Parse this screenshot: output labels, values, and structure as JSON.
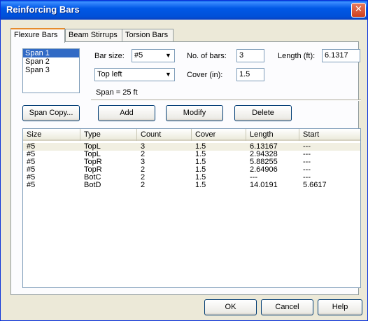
{
  "window": {
    "title": "Reinforcing Bars",
    "close_glyph": "✕"
  },
  "tabs": [
    {
      "label": "Flexure Bars",
      "active": true
    },
    {
      "label": "Beam Stirrups",
      "active": false
    },
    {
      "label": "Torsion Bars",
      "active": false
    }
  ],
  "spans": {
    "items": [
      "Span 1",
      "Span 2",
      "Span 3"
    ],
    "selected": "Span 1"
  },
  "form": {
    "bar_size_label": "Bar size:",
    "bar_size_value": "#5",
    "no_of_bars_label": "No. of bars:",
    "no_of_bars_value": "3",
    "length_label": "Length (ft):",
    "length_value": "6.1317",
    "position_value": "Top left",
    "cover_label": "Cover (in):",
    "cover_value": "1.5",
    "span_info": "Span = 25 ft"
  },
  "buttons": {
    "span_copy": "Span Copy...",
    "add": "Add",
    "modify": "Modify",
    "delete": "Delete",
    "ok": "OK",
    "cancel": "Cancel",
    "help": "Help"
  },
  "table": {
    "columns": [
      "Size",
      "Type",
      "Count",
      "Cover",
      "Length",
      "Start"
    ],
    "rows": [
      [
        "#5",
        "TopL",
        "3",
        "1.5",
        "6.13167",
        "---"
      ],
      [
        "#5",
        "TopL",
        "2",
        "1.5",
        "2.94328",
        "---"
      ],
      [
        "#5",
        "TopR",
        "3",
        "1.5",
        "5.88255",
        "---"
      ],
      [
        "#5",
        "TopR",
        "2",
        "1.5",
        "2.64906",
        "---"
      ],
      [
        "#5",
        "BotC",
        "2",
        "1.5",
        "---",
        "---"
      ],
      [
        "#5",
        "BotD",
        "2",
        "1.5",
        "14.0191",
        "5.6617"
      ]
    ],
    "selected_row": 0
  },
  "icons": {
    "dropdown": "chevron-down-icon",
    "close": "close-icon"
  },
  "colors": {
    "title_bar": "#0058E6",
    "selection": "#316AC5",
    "dialog_bg": "#ECE9D8"
  }
}
